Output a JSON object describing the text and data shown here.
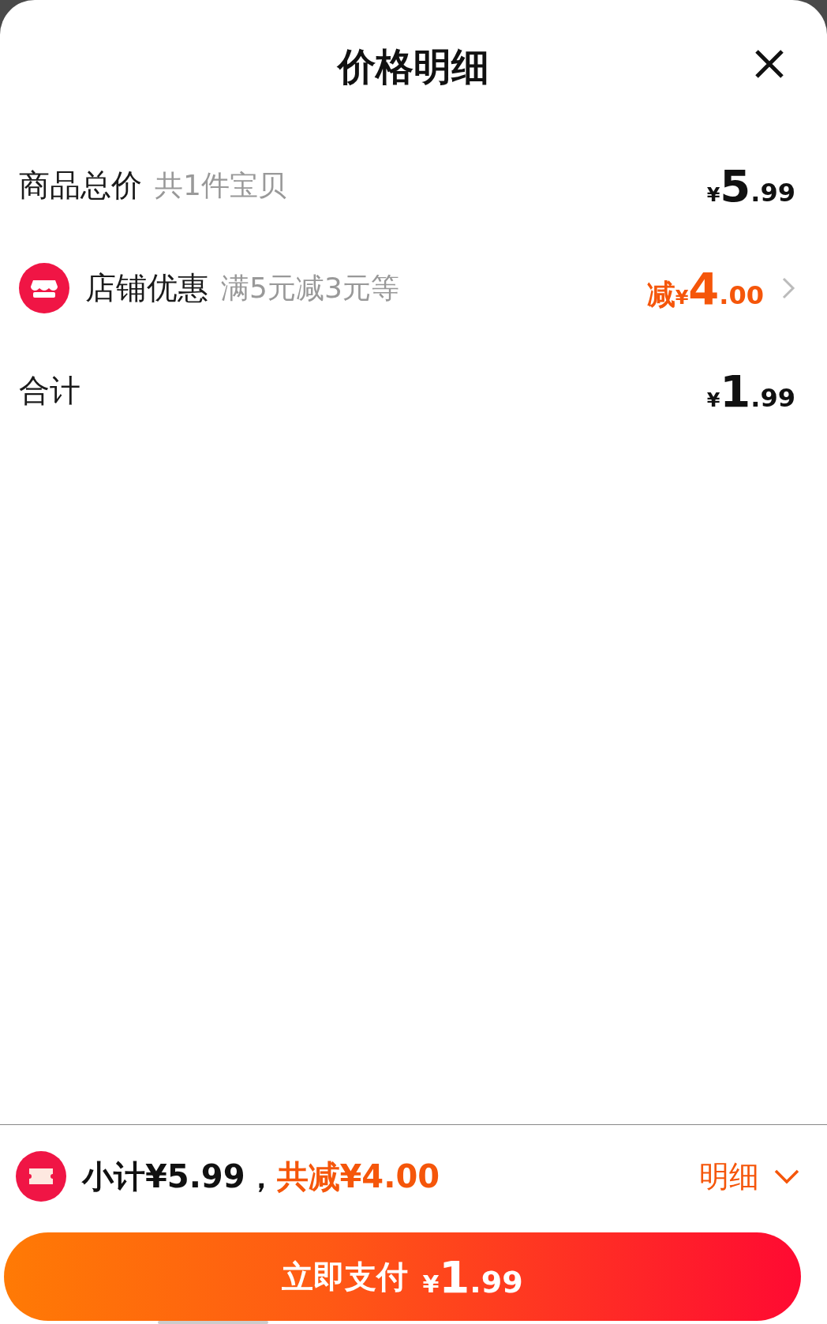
{
  "sheet": {
    "title": "价格明细"
  },
  "rows": [
    {
      "kind": "plain",
      "label": "商品总价",
      "note": "共1件宝贝",
      "price": {
        "currency": "¥",
        "integer": "5",
        "decimal": ".99"
      },
      "highlight": false
    },
    {
      "kind": "discount",
      "label": "店铺优惠",
      "note": "满5元减3元等",
      "price": {
        "prefix": "减",
        "currency": "¥",
        "integer": "4",
        "decimal": ".00"
      },
      "highlight": true
    },
    {
      "kind": "plain",
      "label": "合计",
      "price": {
        "currency": "¥",
        "integer": "1",
        "decimal": ".99"
      },
      "highlight": false
    }
  ],
  "footer": {
    "subtotal": "小计¥5.99，",
    "saved": "共减¥4.00",
    "details": "明细",
    "pay": {
      "label": "立即支付",
      "currency": "¥",
      "integer": "1",
      "decimal": ".99"
    }
  }
}
